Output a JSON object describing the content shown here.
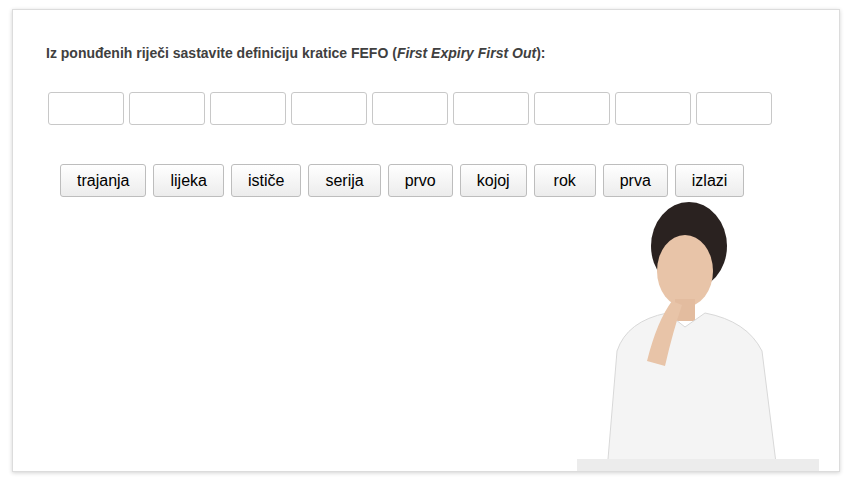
{
  "title": {
    "text": "Iz ponuđenih riječi sastavite definiciju kratice FEFO (",
    "italic": "First Expiry First Out",
    "end": "):"
  },
  "slots": [
    {
      "filled": false
    },
    {
      "filled": false
    },
    {
      "filled": false
    },
    {
      "filled": false
    },
    {
      "filled": false
    },
    {
      "filled": false
    },
    {
      "filled": false
    },
    {
      "filled": false
    },
    {
      "filled": false
    }
  ],
  "words": [
    "trajanja",
    "lijeka",
    "ističe",
    "serija",
    "prvo",
    "kojoj",
    "rok",
    "prva",
    "izlazi"
  ]
}
